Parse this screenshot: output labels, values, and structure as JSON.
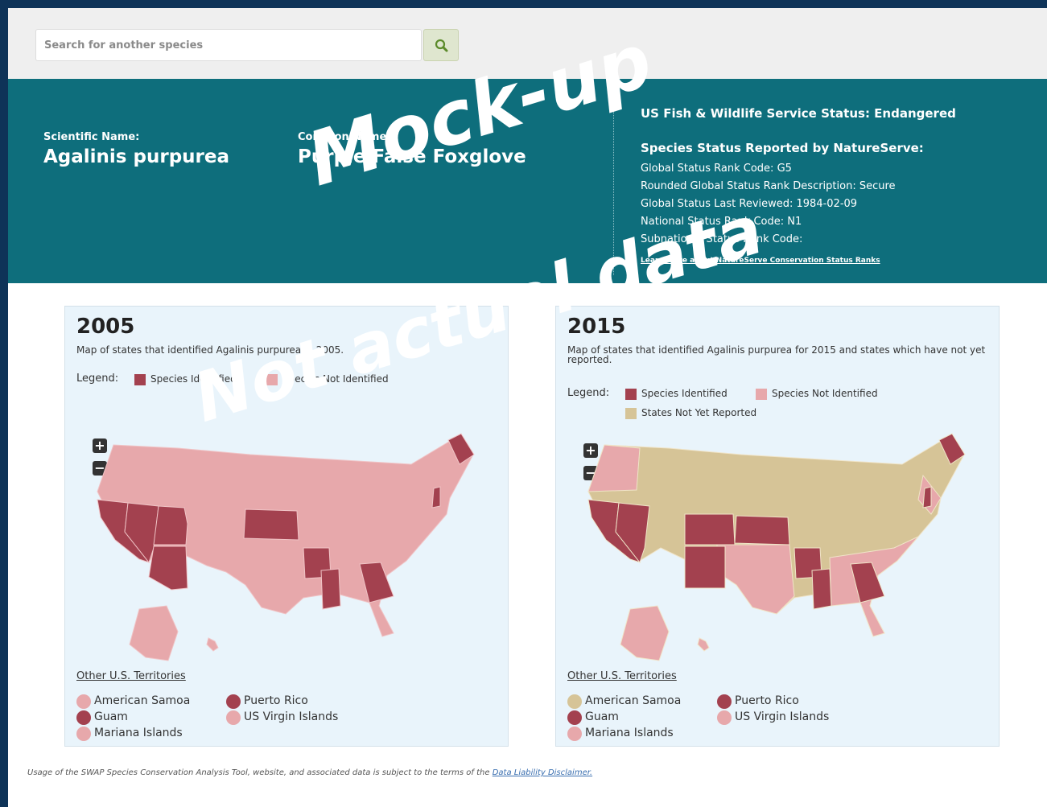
{
  "search": {
    "placeholder": "Search for another species"
  },
  "species": {
    "scientific_label": "Scientific Name:",
    "scientific_name": "Agalinis purpurea",
    "common_label": "Common Name:",
    "common_name": "Purple False Foxglove"
  },
  "status": {
    "usfws": "US Fish & Wildlife Service Status: Endangered",
    "natureserve_title": "Species Status Reported by NatureServe:",
    "lines": [
      "Global Status Rank Code: G5",
      "Rounded Global Status Rank Description: Secure",
      "Global Status Last Reviewed: 1984-02-09",
      "National Status Rank Code: N1",
      "Subnational Status Rank Code:"
    ],
    "learn_more": "Learn more about NatureServe Conservation Status Ranks"
  },
  "colors": {
    "identified": "#a3414f",
    "not_identified": "#e7a8ab",
    "not_reported": "#d6c497"
  },
  "panels": [
    {
      "year": "2005",
      "description": "Map of states that identified Agalinis purpurea in 2005.",
      "legend_label": "Legend:",
      "legend_items": [
        "Species Identified",
        "Species Not Identified"
      ],
      "territories_title": "Other U.S. Territories",
      "territories": [
        {
          "name": "American Samoa",
          "status": "not_identified"
        },
        {
          "name": "Puerto Rico",
          "status": "identified"
        },
        {
          "name": "Guam",
          "status": "identified"
        },
        {
          "name": "US Virgin Islands",
          "status": "not_identified"
        },
        {
          "name": "Mariana Islands",
          "status": "not_identified"
        }
      ]
    },
    {
      "year": "2015",
      "description": "Map of states that identified Agalinis purpurea for 2015 and states which have not yet reported.",
      "legend_label": "Legend:",
      "legend_items": [
        "Species Identified",
        "Species Not Identified",
        "States Not Yet Reported"
      ],
      "territories_title": "Other U.S. Territories",
      "territories": [
        {
          "name": "American Samoa",
          "status": "not_reported"
        },
        {
          "name": "Puerto Rico",
          "status": "identified"
        },
        {
          "name": "Guam",
          "status": "identified"
        },
        {
          "name": "US Virgin Islands",
          "status": "not_identified"
        },
        {
          "name": "Mariana Islands",
          "status": "not_identified"
        }
      ]
    }
  ],
  "footer": {
    "text": "Usage of the SWAP Species Conservation Analysis Tool, website, and associated data is subject to the terms of the",
    "link": "Data Liability Disclaimer."
  },
  "watermark": {
    "line1": "Mock-up",
    "line2": "Not actual data"
  }
}
